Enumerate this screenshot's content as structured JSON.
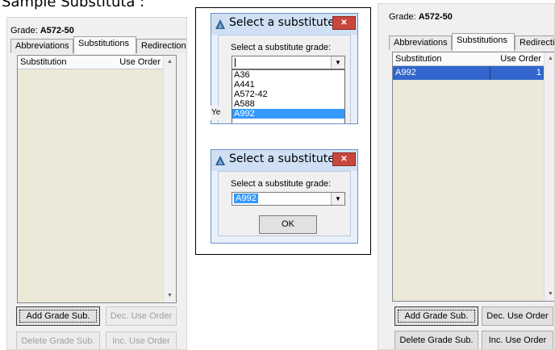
{
  "caption": "Sample Substituta :",
  "left_panel": {
    "grade_label": "Grade:",
    "grade_value": "A572-50",
    "tabs": [
      "Abbreviations",
      "Substitutions",
      "Redirections"
    ],
    "active_tab": "Substitutions",
    "columns": [
      "Substitution",
      "Use Order"
    ],
    "rows": [],
    "buttons": {
      "add": "Add Grade Sub.",
      "dec": "Dec. Use Order",
      "delete": "Delete Grade Sub.",
      "inc": "Inc. Use Order"
    }
  },
  "dialog_open": {
    "title": "Select a substitute...",
    "prompt": "Select a substitute grade:",
    "value": "",
    "options": [
      "A36",
      "A441",
      "A572-42",
      "A588",
      "A992"
    ],
    "highlighted": "A992",
    "background_fragment": "Ye"
  },
  "dialog_selected": {
    "title": "Select a substitute...",
    "prompt": "Select a substitute grade:",
    "value": "A992",
    "ok_label": "OK"
  },
  "right_panel": {
    "grade_label": "Grade:",
    "grade_value": "A572-50",
    "tabs": [
      "Abbreviations",
      "Substitutions",
      "Redirections"
    ],
    "active_tab": "Substitutions",
    "columns": [
      "Substitution",
      "Use Order"
    ],
    "rows": [
      {
        "substitution": "A992",
        "use_order": "1"
      }
    ],
    "buttons": {
      "add": "Add Grade Sub.",
      "dec": "Dec. Use Order",
      "delete": "Delete Grade Sub.",
      "inc": "Inc. Use Order"
    }
  },
  "colors": {
    "list_background": "#ece9d8",
    "selection": "#3366cc",
    "dropdown_highlight": "#3399ff",
    "close_button": "#c9463d",
    "dialog_frame": "#cfe0f5"
  }
}
